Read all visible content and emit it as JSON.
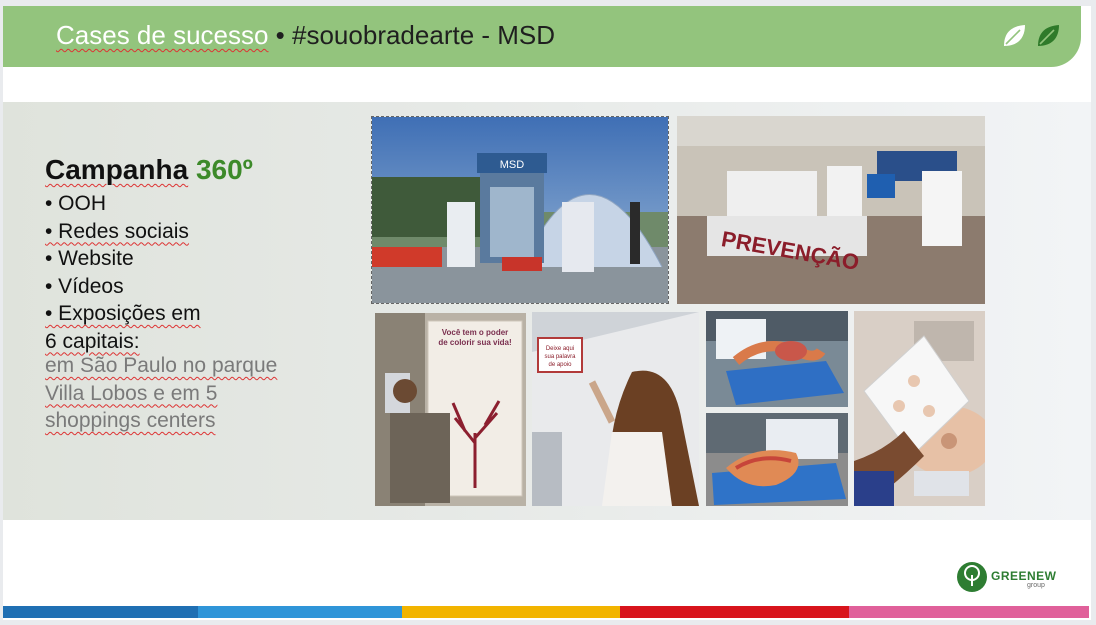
{
  "header": {
    "title_part1": "Cases de sucesso",
    "title_sep": " • ",
    "title_part2": "#souobradearte - MSD"
  },
  "content": {
    "heading_word": "Campanha",
    "heading_number": "360º",
    "bullets": [
      "• OOH",
      "• Redes sociais",
      "• Website",
      "• Vídeos",
      "• Exposições em",
      "6 capitais:"
    ],
    "detail_lines": [
      "em São Paulo no parque",
      "Villa Lobos e em 5",
      "shoppings centers"
    ]
  },
  "photos": {
    "dome_sign": "MSD",
    "mall_sign": "PREVENÇÃO",
    "poster_line1": "Você tem o poder",
    "poster_line2": "de colorir sua vida!",
    "wall_note_line1": "Deixe aqui",
    "wall_note_line2": "sua palavra",
    "wall_note_line3": "de apoio"
  },
  "footer": {
    "logo_name": "GREENEW",
    "logo_sub": "group"
  },
  "colors": {
    "header_green": "#93c47d",
    "accent_green": "#3d8a2a",
    "bar_colors": [
      "#1f6fb3",
      "#2f95d8",
      "#f2b400",
      "#d8141c",
      "#e0609a"
    ]
  },
  "icons": [
    "leaf-outline-icon",
    "leaf-filled-icon",
    "tree-logo-icon"
  ]
}
